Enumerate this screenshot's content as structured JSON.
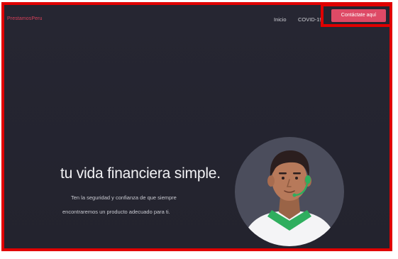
{
  "header": {
    "logo": "PrestamosPeru",
    "nav": {
      "inicio": "Inicio",
      "covid": "COVID-19"
    },
    "cta_label": "Contáctate aquí"
  },
  "hero": {
    "title": "tu vida financiera simple.",
    "subtitle_line1": "Ten la seguridad y confianza de que siempre",
    "subtitle_line2": "encontraremos un producto adecuado para ti."
  },
  "colors": {
    "background": "#252531",
    "accent": "#de4a66",
    "highlight_border": "#e00000",
    "avatar_circle": "#4b4d5c",
    "shirt_collar": "#2fae5e"
  },
  "icons": {
    "avatar": "support-agent-with-headset"
  }
}
